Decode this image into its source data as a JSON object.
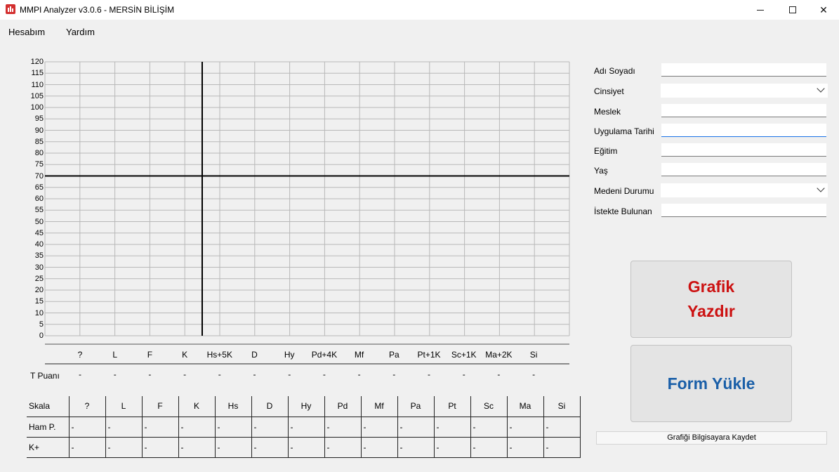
{
  "window": {
    "title": "MMPI Analyzer v3.0.6 - MERSİN BİLİŞİM",
    "minimize_symbol": "minimize",
    "maximize_symbol": "maximize",
    "close_symbol": "✕"
  },
  "menu": {
    "items": [
      {
        "label": "Hesabım"
      },
      {
        "label": "Yardım"
      }
    ]
  },
  "chart_data": {
    "type": "line",
    "ylim": [
      0,
      120
    ],
    "y_ticks": [
      "120",
      "115",
      "110",
      "105",
      "100",
      "95",
      "90",
      "85",
      "80",
      "75",
      "70",
      "65",
      "60",
      "55",
      "50",
      "45",
      "40",
      "35",
      "30",
      "25",
      "20",
      "15",
      "10",
      "5",
      "0"
    ],
    "categories": [
      "?",
      "L",
      "F",
      "K",
      "Hs+5K",
      "D",
      "Hy",
      "Pd+4K",
      "Mf",
      "Pa",
      "Pt+1K",
      "Sc+1K",
      "Ma+2K",
      "Si"
    ],
    "reference_line_y": 70,
    "series": []
  },
  "t_puani": {
    "label": "T Puanı",
    "values": [
      "-",
      "-",
      "-",
      "-",
      "-",
      "-",
      "-",
      "-",
      "-",
      "-",
      "-",
      "-",
      "-",
      "-"
    ]
  },
  "skala_table": {
    "header_label": "Skala",
    "columns": [
      "?",
      "L",
      "F",
      "K",
      "Hs",
      "D",
      "Hy",
      "Pd",
      "Mf",
      "Pa",
      "Pt",
      "Sc",
      "Ma",
      "Si"
    ],
    "rows": [
      {
        "label": "Ham P.",
        "values": [
          "-",
          "-",
          "-",
          "-",
          "-",
          "-",
          "-",
          "-",
          "-",
          "-",
          "-",
          "-",
          "-",
          "-"
        ]
      },
      {
        "label": "K+",
        "values": [
          "-",
          "-",
          "-",
          "-",
          "-",
          "-",
          "-",
          "-",
          "-",
          "-",
          "-",
          "-",
          "-",
          "-"
        ]
      }
    ]
  },
  "form": {
    "ad_soyad": {
      "label": "Adı Soyadı",
      "value": ""
    },
    "cinsiyet": {
      "label": "Cinsiyet",
      "value": ""
    },
    "meslek": {
      "label": "Meslek",
      "value": ""
    },
    "uygulama_tarihi": {
      "label": "Uygulama Tarihi",
      "value": ""
    },
    "egitim": {
      "label": "Eğitim",
      "value": ""
    },
    "yas": {
      "label": "Yaş",
      "value": ""
    },
    "medeni_durum": {
      "label": "Medeni Durumu",
      "value": ""
    },
    "istekte_bulunan": {
      "label": "İstekte Bulunan",
      "value": ""
    }
  },
  "buttons": {
    "grafik_yazdir_line1": "Grafik",
    "grafik_yazdir_line2": "Yazdır",
    "form_yukle": "Form Yükle",
    "grafigi_kaydet": "Grafiği Bilgisayara Kaydet"
  },
  "colors": {
    "grafik_button_text": "#cc1111",
    "form_button_text": "#1a5fa8",
    "grid_line": "#b8b8b8",
    "reference_line": "#000000"
  }
}
